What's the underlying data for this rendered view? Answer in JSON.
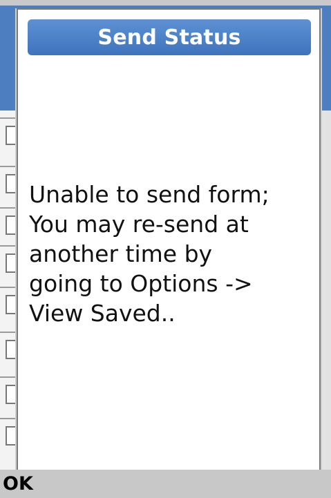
{
  "dialog": {
    "title": "Send Status",
    "message_lines": [
      "Unable to send form;",
      "You may re-send at",
      "another time by",
      "going to Options ->",
      "View Saved.."
    ]
  },
  "softkeys": {
    "left_label": "OK"
  },
  "colors": {
    "title_bar": "#4a80c8",
    "app_header": "#4d7fc0",
    "softkey_bar": "#c8c8c8"
  }
}
